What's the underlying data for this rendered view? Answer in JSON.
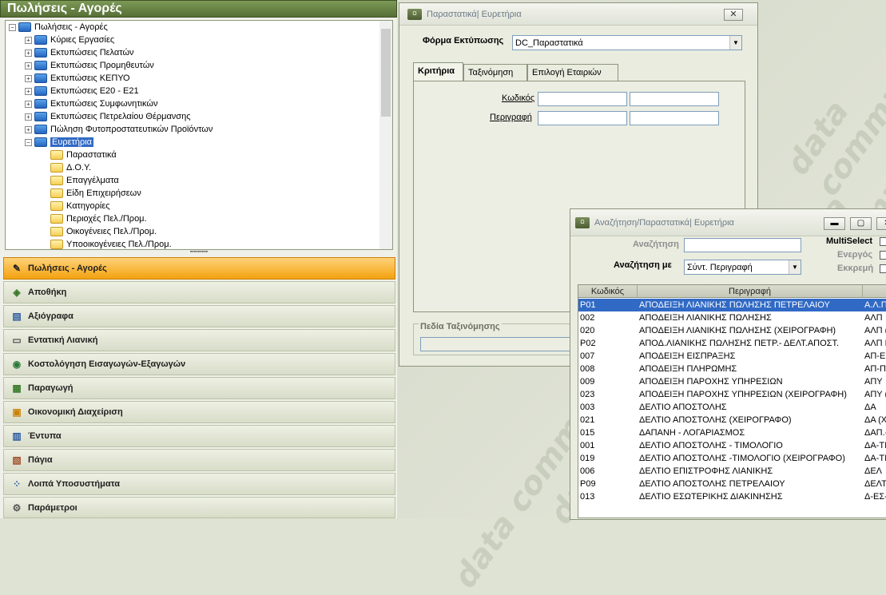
{
  "left_panel": {
    "title": "Πωλήσεις - Αγορές",
    "tree": {
      "root": "Πωλήσεις - Αγορές",
      "items": [
        "Κύριες Εργασίες",
        "Εκτυπώσεις Πελατών",
        "Εκτυπώσεις Προμηθευτών",
        "Εκτυπώσεις ΚΕΠΥΟ",
        "Εκτυπώσεις Ε20 - Ε21",
        "Εκτυπώσεις Συμφωνητικών",
        "Εκτυπώσεις Πετρελαίου Θέρμανσης",
        "Πώληση Φυτοπροστατευτικών Προϊόντων"
      ],
      "selected": "Ευρετήρια",
      "children": [
        "Παραστατικά",
        "Δ.Ο.Υ.",
        "Επαγγέλματα",
        "Είδη Επιχειρήσεων",
        "Κατηγορίες",
        "Περιοχές Πελ./Προμ.",
        "Οικογένειες Πελ./Προμ.",
        "Υποοικογένειες Πελ./Προμ."
      ]
    },
    "nav": [
      {
        "label": "Πωλήσεις - Αγορές",
        "icon": "sales-icon",
        "active": true
      },
      {
        "label": "Αποθήκη",
        "icon": "warehouse-icon",
        "active": false
      },
      {
        "label": "Αξιόγραφα",
        "icon": "securities-icon",
        "active": false
      },
      {
        "label": "Εντατική Λιανική",
        "icon": "retail-icon",
        "active": false
      },
      {
        "label": "Κοστολόγηση Εισαγωγών-Εξαγωγών",
        "icon": "globe-icon",
        "active": false
      },
      {
        "label": "Παραγωγή",
        "icon": "production-icon",
        "active": false
      },
      {
        "label": "Οικονομική Διαχείριση",
        "icon": "finance-icon",
        "active": false
      },
      {
        "label": "Έντυπα",
        "icon": "forms-icon",
        "active": false
      },
      {
        "label": "Πάγια",
        "icon": "assets-icon",
        "active": false
      },
      {
        "label": "Λοιπά Υποσυστήματα",
        "icon": "subsystems-icon",
        "active": false
      },
      {
        "label": "Παράμετροι",
        "icon": "gear-icon",
        "active": false
      }
    ]
  },
  "win1": {
    "title": "Παραστατικά| Ευρετήρια",
    "print_form_label": "Φόρμα Εκτύπωσης",
    "print_form_value": "DC_Παραστατικά",
    "tabs": [
      "Κριτήρια",
      "Ταξινόμηση",
      "Επιλογή Εταιριών"
    ],
    "code_label": "Κωδικός",
    "desc_label": "Περιγραφή",
    "sort_fields_label": "Πεδία Ταξινόμησης"
  },
  "win2": {
    "title": "Αναζήτηση/Παραστατικά| Ευρετήρια",
    "search_label": "Αναζήτηση",
    "search_with_label": "Αναζήτηση με",
    "search_with_value": "Σύντ. Περιγραφή",
    "multiselect_label": "MultiSelect",
    "active_label": "Ενεργός",
    "pending_label": "Εκκρεμή",
    "columns": [
      "Κωδικός",
      "Περιγραφή",
      ""
    ],
    "rows": [
      [
        "P01",
        "ΑΠΟΔΕΙΞΗ ΛΙΑΝΙΚΗΣ ΠΩΛΗΣΗΣ ΠΕΤΡΕΛΑΙΟΥ",
        "Α.Λ.Π"
      ],
      [
        "002",
        "ΑΠΟΔΕΙΞΗ ΛΙΑΝΙΚΗΣ ΠΩΛΗΣΗΣ",
        "ΑΛΠ"
      ],
      [
        "020",
        "ΑΠΟΔΕΙΞΗ ΛΙΑΝΙΚΗΣ ΠΩΛΗΣΗΣ (ΧΕΙΡΟΓΡΑΦΗ)",
        "ΑΛΠ ("
      ],
      [
        "P02",
        "ΑΠΟΔ.ΛΙΑΝΙΚΗΣ ΠΩΛΗΣΗΣ ΠΕΤΡ.- ΔΕΛΤ.ΑΠΟΣΤ.",
        "ΑΛΠ Π"
      ],
      [
        "007",
        "ΑΠΟΔΕΙΞΗ ΕΙΣΠΡΑΞΗΣ",
        "ΑΠ-ΕΙΣ"
      ],
      [
        "008",
        "ΑΠΟΔΕΙΞΗ ΠΛΗΡΩΜΗΣ",
        "ΑΠ-ΠΛ"
      ],
      [
        "009",
        "ΑΠΟΔΕΙΞΗ ΠΑΡΟΧΗΣ ΥΠΗΡΕΣΙΩΝ",
        "ΑΠΥ"
      ],
      [
        "023",
        "ΑΠΟΔΕΙΞΗ ΠΑΡΟΧΗΣ ΥΠΗΡΕΣΙΩΝ (ΧΕΙΡΟΓΡΑΦΗ)",
        "ΑΠΥ ("
      ],
      [
        "003",
        "ΔΕΛΤΙΟ ΑΠΟΣΤΟΛΗΣ",
        "ΔΑ"
      ],
      [
        "021",
        "ΔΕΛΤΙΟ ΑΠΟΣΤΟΛΗΣ (ΧΕΙΡΟΓΡΑΦΟ)",
        "ΔΑ (Χ"
      ],
      [
        "015",
        "ΔΑΠΑΝΗ - ΛΟΓΑΡΙΑΣΜΟΣ",
        "ΔΑΠ.-"
      ],
      [
        "001",
        "ΔΕΛΤΙΟ ΑΠΟΣΤΟΛΗΣ - ΤΙΜΟΛΟΓΙΟ",
        "ΔΑ-ΤΙΜ"
      ],
      [
        "019",
        "ΔΕΛΤΙΟ ΑΠΟΣΤΟΛΗΣ -ΤΙΜΟΛΟΓΙΟ (ΧΕΙΡΟΓΡΑΦΟ)",
        "ΔΑ-ΤΙΜ"
      ],
      [
        "006",
        "ΔΕΛΤΙΟ ΕΠΙΣΤΡΟΦΗΣ ΛΙΑΝΙΚΗΣ",
        "ΔΕΛ"
      ],
      [
        "P09",
        "ΔΕΛΤΙΟ ΑΠΟΣΤΟΛΗΣ ΠΕΤΡΕΛΑΙΟΥ",
        "ΔΕΛΤ."
      ],
      [
        "013",
        "ΔΕΛΤΙΟ ΕΣΩΤΕΡΙΚΗΣ ΔΙΑΚΙΝΗΣΗΣ",
        "Δ-ΕΣ-Δ"
      ]
    ]
  },
  "watermark_text": "data communication"
}
